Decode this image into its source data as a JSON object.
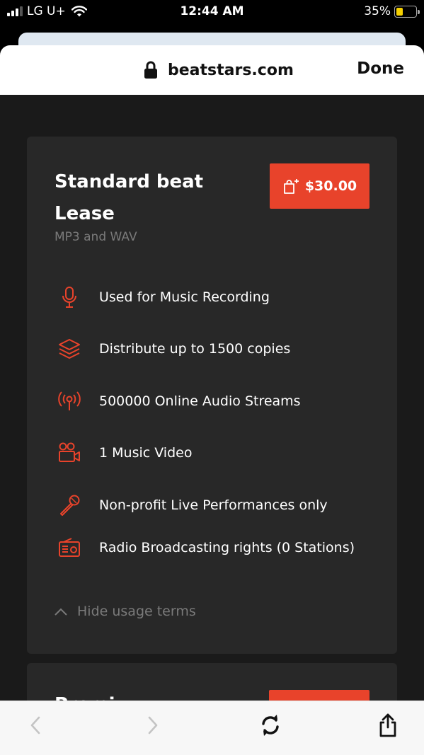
{
  "status_bar": {
    "carrier": "LG U+",
    "time": "12:44 AM",
    "battery_percent": "35%",
    "battery_level": 0.35,
    "battery_color": "#f5d000"
  },
  "browser": {
    "url": "beatstars.com",
    "done_label": "Done",
    "icons": [
      "lock-icon",
      "back-icon",
      "forward-icon",
      "reload-icon",
      "share-icon"
    ]
  },
  "license": {
    "title": "Standard beat Lease",
    "subtitle": "MP3 and WAV",
    "price": "$30.00",
    "accent_color": "#e8432b",
    "terms": [
      {
        "icon": "microphone-icon",
        "text": "Used for Music Recording"
      },
      {
        "icon": "layers-icon",
        "text": "Distribute up to 1500 copies"
      },
      {
        "icon": "broadcast-icon",
        "text": "500000 Online Audio Streams"
      },
      {
        "icon": "video-camera-icon",
        "text": "1 Music Video"
      },
      {
        "icon": "handheld-mic-icon",
        "text": "Non-profit Live Performances only"
      },
      {
        "icon": "radio-icon",
        "text": "Radio Broadcasting rights (0 Stations)"
      }
    ],
    "hide_terms_label": "Hide usage terms"
  },
  "next_card": {
    "title_peek": "Premi"
  }
}
